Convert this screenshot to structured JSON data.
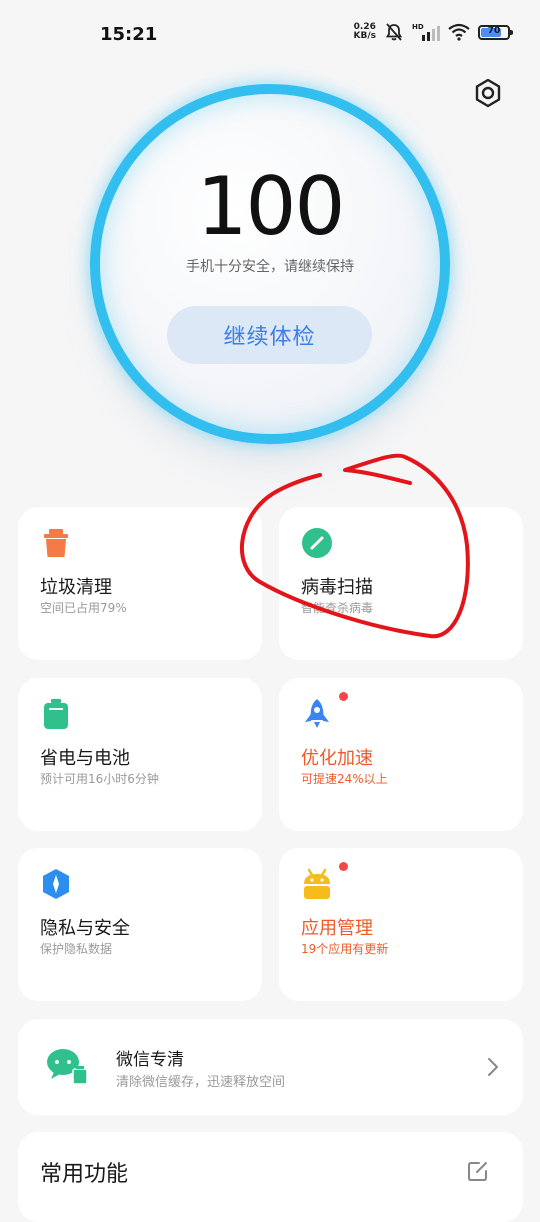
{
  "status_bar": {
    "time": "15:21",
    "net_speed_value": "0.26",
    "net_speed_unit": "KB/s",
    "network_label": "HD",
    "battery_level": "70"
  },
  "hero": {
    "score": "100",
    "subtitle": "手机十分安全，请继续保持",
    "button_label": "继续体检",
    "ring_color": "#32bff0"
  },
  "cards": [
    {
      "title": "垃圾清理",
      "subtitle": "空间已占用79%",
      "icon": "trash-icon",
      "color": "#f57a45"
    },
    {
      "title": "病毒扫描",
      "subtitle": "智能查杀病毒",
      "icon": "virus-scan-icon",
      "color": "#2fc08c"
    },
    {
      "title": "省电与电池",
      "subtitle": "预计可用16小时6分钟",
      "icon": "battery-icon",
      "color": "#2fc08c"
    },
    {
      "title": "优化加速",
      "subtitle": "可提速24%以上",
      "icon": "rocket-icon",
      "color": "#3a86f0",
      "badge": true
    },
    {
      "title": "隐私与安全",
      "subtitle": "保护隐私数据",
      "icon": "shield-icon",
      "color": "#2c8ff0"
    },
    {
      "title": "应用管理",
      "subtitle": "19个应用有更新",
      "icon": "android-icon",
      "color": "#f6bc1d",
      "badge": true
    }
  ],
  "wechat": {
    "title": "微信专清",
    "subtitle": "清除微信缓存，迅速释放空间",
    "icon": "wechat-clean-icon",
    "color": "#2fc08c"
  },
  "common": {
    "title": "常用功能",
    "icon": "edit-icon"
  },
  "accent_red": "#f05a2b",
  "annotation_color": "#e3151b"
}
